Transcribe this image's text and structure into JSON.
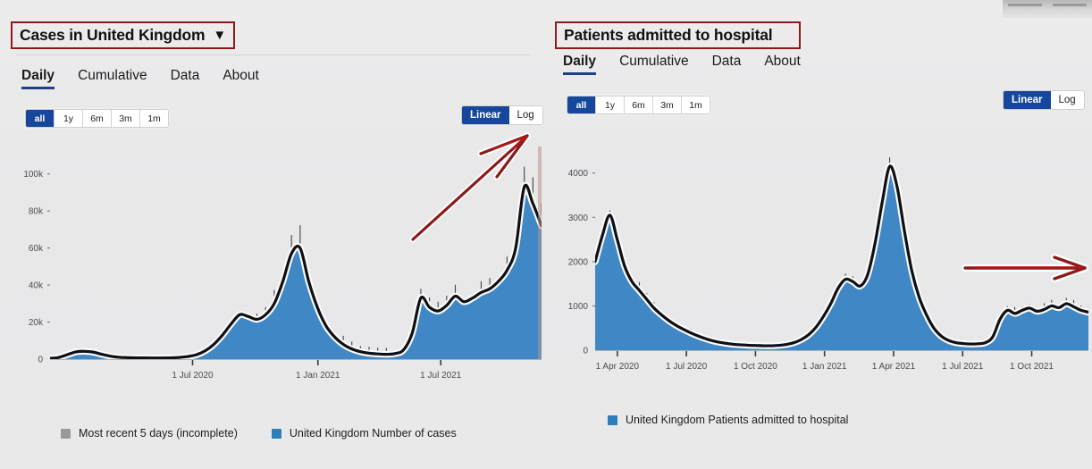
{
  "page": {
    "background_color": "#e9e9ea",
    "annotation_color": "#8d1a1a"
  },
  "left_panel": {
    "title": "Cases in United Kingdom",
    "title_caret_icon": "chevron-down-icon",
    "tabs": [
      {
        "label": "Daily",
        "active": true
      },
      {
        "label": "Cumulative",
        "active": false
      },
      {
        "label": "Data",
        "active": false
      },
      {
        "label": "About",
        "active": false
      }
    ],
    "range_buttons": [
      {
        "label": "all",
        "selected": true
      },
      {
        "label": "1y",
        "selected": false
      },
      {
        "label": "6m",
        "selected": false
      },
      {
        "label": "3m",
        "selected": false
      },
      {
        "label": "1m",
        "selected": false
      }
    ],
    "scale_buttons": [
      {
        "label": "Linear",
        "selected": true
      },
      {
        "label": "Log",
        "selected": false
      }
    ],
    "legend": [
      {
        "label": "Most recent 5 days (incomplete)",
        "color": "#9a9a9a"
      },
      {
        "label": "United Kingdom Number of cases",
        "color": "#2e7ebb"
      }
    ]
  },
  "right_panel": {
    "title": "Patients admitted to hospital",
    "tabs": [
      {
        "label": "Daily",
        "active": true
      },
      {
        "label": "Cumulative",
        "active": false
      },
      {
        "label": "Data",
        "active": false
      },
      {
        "label": "About",
        "active": false
      }
    ],
    "range_buttons": [
      {
        "label": "all",
        "selected": true
      },
      {
        "label": "1y",
        "selected": false
      },
      {
        "label": "6m",
        "selected": false
      },
      {
        "label": "3m",
        "selected": false
      },
      {
        "label": "1m",
        "selected": false
      }
    ],
    "scale_buttons": [
      {
        "label": "Linear",
        "selected": true
      },
      {
        "label": "Log",
        "selected": false
      }
    ],
    "legend": [
      {
        "label": "United Kingdom Patients admitted to hospital",
        "color": "#2e7ebb"
      }
    ]
  },
  "annotations": [
    {
      "name": "diagonal-arrow",
      "color": "#8d1a1a",
      "direction": "up-right"
    },
    {
      "name": "horizontal-arrow",
      "color": "#8d1a1a",
      "direction": "right"
    }
  ],
  "chart_data": [
    {
      "id": "cases-chart",
      "type": "area",
      "title": "Cases in United Kingdom",
      "series_name": "United Kingdom Number of cases",
      "xlabel": "",
      "ylabel": "",
      "ylim": [
        0,
        110000
      ],
      "yticks": [
        0,
        20000,
        40000,
        60000,
        80000,
        100000
      ],
      "ytick_labels": [
        "0",
        "20k",
        "40k",
        "60k",
        "80k",
        "100k"
      ],
      "xticks": [
        "1 Jul 2020",
        "1 Jan 2021",
        "1 Jul 2021"
      ],
      "xtick_positions": [
        0.29,
        0.545,
        0.795
      ],
      "grid": false,
      "legend_position": "bottom",
      "line_color": "#0f0f14",
      "fill_color": "#3f88c5",
      "x": [
        0.0,
        0.02,
        0.04,
        0.06,
        0.08,
        0.1,
        0.12,
        0.14,
        0.16,
        0.18,
        0.2,
        0.22,
        0.24,
        0.26,
        0.28,
        0.3,
        0.32,
        0.34,
        0.36,
        0.38,
        0.4,
        0.42,
        0.44,
        0.46,
        0.48,
        0.5,
        0.52,
        0.54,
        0.56,
        0.58,
        0.6,
        0.62,
        0.64,
        0.66,
        0.68,
        0.7,
        0.72,
        0.74,
        0.76,
        0.78,
        0.8,
        0.82,
        0.84,
        0.86,
        0.88,
        0.9,
        0.92,
        0.94,
        0.96,
        0.98,
        1.0
      ],
      "values": [
        400,
        900,
        2400,
        3900,
        4200,
        3800,
        2600,
        1600,
        1000,
        800,
        700,
        650,
        600,
        600,
        700,
        900,
        1400,
        2400,
        4500,
        8000,
        13000,
        19000,
        24000,
        23000,
        21500,
        24000,
        30000,
        42000,
        57000,
        60000,
        42000,
        28000,
        18000,
        12000,
        8000,
        5500,
        4000,
        3200,
        2800,
        2600,
        3000,
        5000,
        14000,
        33000,
        28000,
        26000,
        29000,
        34000,
        31000,
        33000,
        36000,
        38000,
        42000,
        48000,
        60000,
        93000,
        84000,
        72000
      ],
      "annotation": "red diagonal arrow pointing to the steep rise at the right end"
    },
    {
      "id": "hospital-chart",
      "type": "area",
      "title": "Patients admitted to hospital",
      "series_name": "United Kingdom Patients admitted to hospital",
      "xlabel": "",
      "ylabel": "",
      "ylim": [
        0,
        4600
      ],
      "yticks": [
        0,
        1000,
        2000,
        3000,
        4000
      ],
      "ytick_labels": [
        "0",
        "1000",
        "2000",
        "3000",
        "4000"
      ],
      "xticks": [
        "1 Apr 2020",
        "1 Jul 2020",
        "1 Oct 2020",
        "1 Jan 2021",
        "1 Apr 2021",
        "1 Jul 2021",
        "1 Oct 2021"
      ],
      "xtick_positions": [
        0.045,
        0.185,
        0.325,
        0.465,
        0.605,
        0.745,
        0.885
      ],
      "grid": false,
      "legend_position": "bottom",
      "line_color": "#0f0f14",
      "fill_color": "#3f88c5",
      "x": [
        0.0,
        0.02,
        0.04,
        0.06,
        0.08,
        0.1,
        0.12,
        0.14,
        0.16,
        0.18,
        0.2,
        0.22,
        0.24,
        0.26,
        0.28,
        0.3,
        0.32,
        0.34,
        0.36,
        0.38,
        0.4,
        0.42,
        0.44,
        0.46,
        0.48,
        0.5,
        0.52,
        0.54,
        0.56,
        0.58,
        0.6,
        0.62,
        0.64,
        0.66,
        0.68,
        0.7,
        0.72,
        0.74,
        0.76,
        0.78,
        0.8,
        0.82,
        0.84,
        0.86,
        0.88,
        0.9,
        0.92,
        0.94,
        0.96,
        0.98,
        1.0
      ],
      "values": [
        2000,
        2600,
        3050,
        2500,
        1900,
        1550,
        1350,
        1150,
        950,
        800,
        670,
        560,
        470,
        390,
        320,
        260,
        210,
        175,
        150,
        130,
        120,
        110,
        105,
        100,
        100,
        110,
        130,
        170,
        240,
        350,
        520,
        760,
        1050,
        1400,
        1600,
        1550,
        1450,
        1700,
        2400,
        3350,
        4150,
        3700,
        2700,
        1800,
        1200,
        800,
        500,
        320,
        220,
        170,
        150,
        140,
        145,
        170,
        300,
        700,
        900,
        830,
        900,
        950,
        880,
        920,
        1000,
        960,
        1050,
        980,
        900,
        860
      ],
      "annotation": "red horizontal arrow pointing right toward the flat right-hand tail"
    }
  ]
}
